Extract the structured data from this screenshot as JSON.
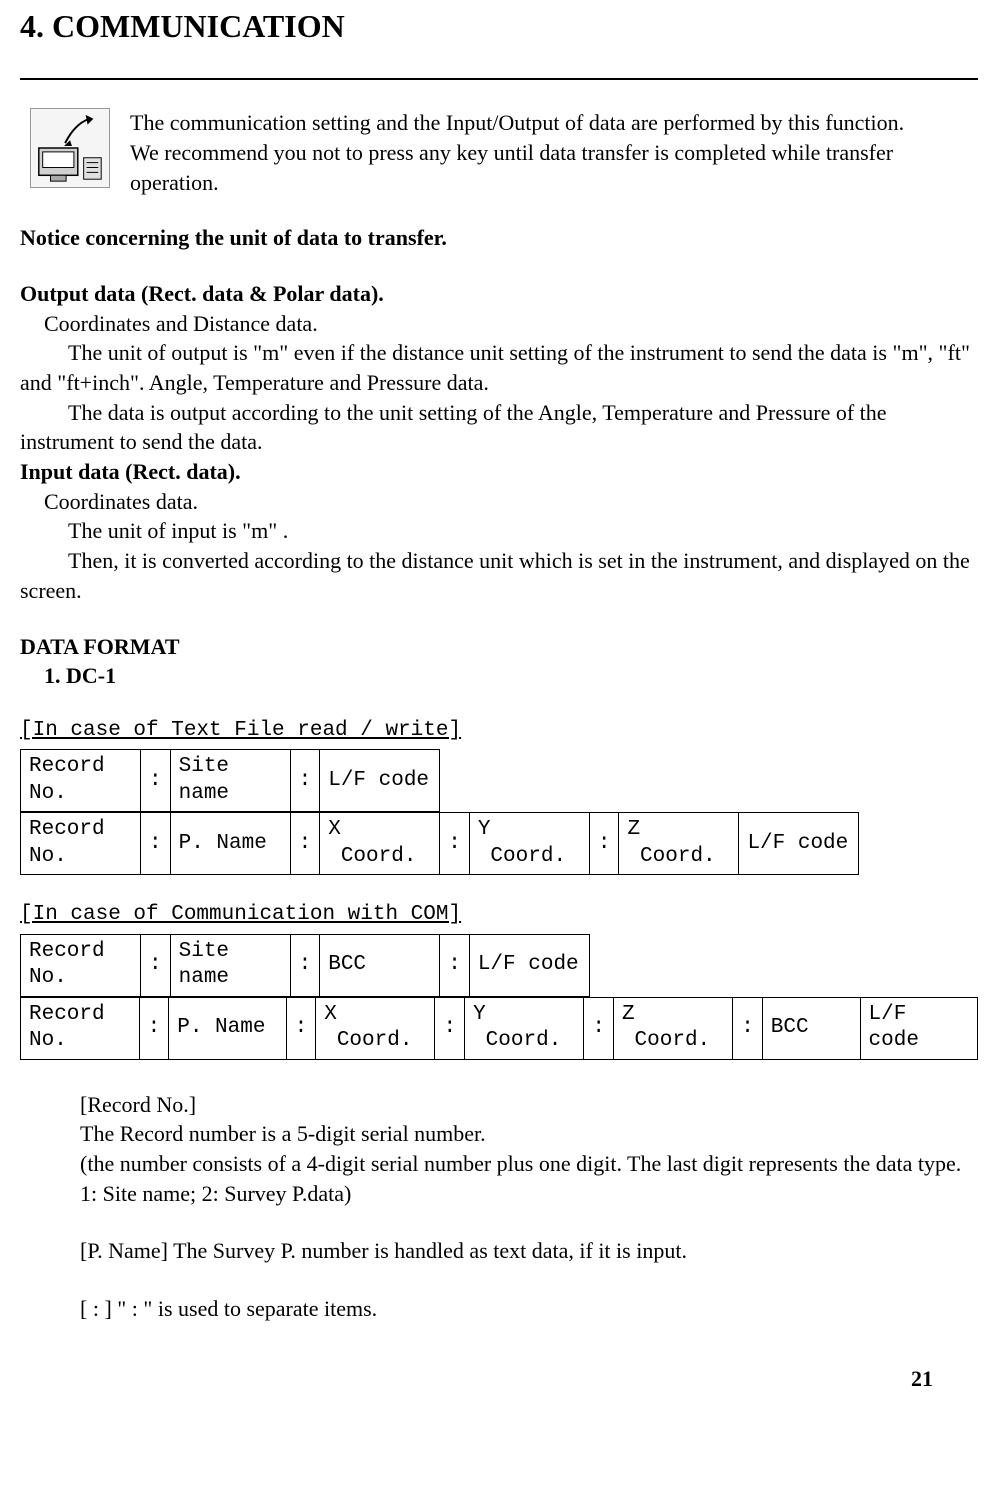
{
  "title": "4. COMMUNICATION",
  "intro": {
    "p1": "The communication setting and the Input/Output of data are performed by this function.",
    "p2": "We recommend you not to press any key until data transfer is completed while transfer operation."
  },
  "notice_heading": "Notice concerning the unit of data to transfer.",
  "output_heading": "Output data (Rect. data & Polar data).",
  "output_sub": "Coordinates and Distance data.",
  "output_p1": "The unit of output is \"m\"  even if the distance unit setting of the instrument to send the data is \"m\", \"ft\" and \"ft+inch\". Angle, Temperature and Pressure data.",
  "output_p2": "The data is output according to the unit setting of the Angle, Temperature and Pressure of the instrument to send the data.",
  "input_heading": "Input data (Rect. data).",
  "input_sub": "Coordinates data.",
  "input_p1": "The unit of input is \"m\" .",
  "input_p2": "Then, it is converted according to the distance unit which is set in the instrument, and displayed on the screen.",
  "data_format_heading": "DATA FORMAT",
  "dc1_heading": "1. DC-1",
  "text_file_label": "[In case of Text File read / write]",
  "com_label": "[In case of Communication with COM]",
  "cells": {
    "record_no": "Record No.",
    "site_name": "Site name",
    "lf_code": "L/F code",
    "p_name": "P. Name",
    "x_coord": "X\n Coord.",
    "y_coord": "Y\n Coord.",
    "z_coord": "Z\n Coord.",
    "bcc": "BCC",
    "sep": ":"
  },
  "record_no_label": "[Record No.]",
  "record_no_desc1": "The Record number is a 5-digit serial number.",
  "record_no_desc2": "(the number consists of a 4-digit serial number plus one digit. The last digit represents the data type. 1: Site name; 2: Survey P.data)",
  "pname_desc": "[P. Name] The Survey P. number is handled as text data, if it is input.",
  "sep_desc": "[ : ] \" : \"  is used to separate items.",
  "page_num": "21"
}
